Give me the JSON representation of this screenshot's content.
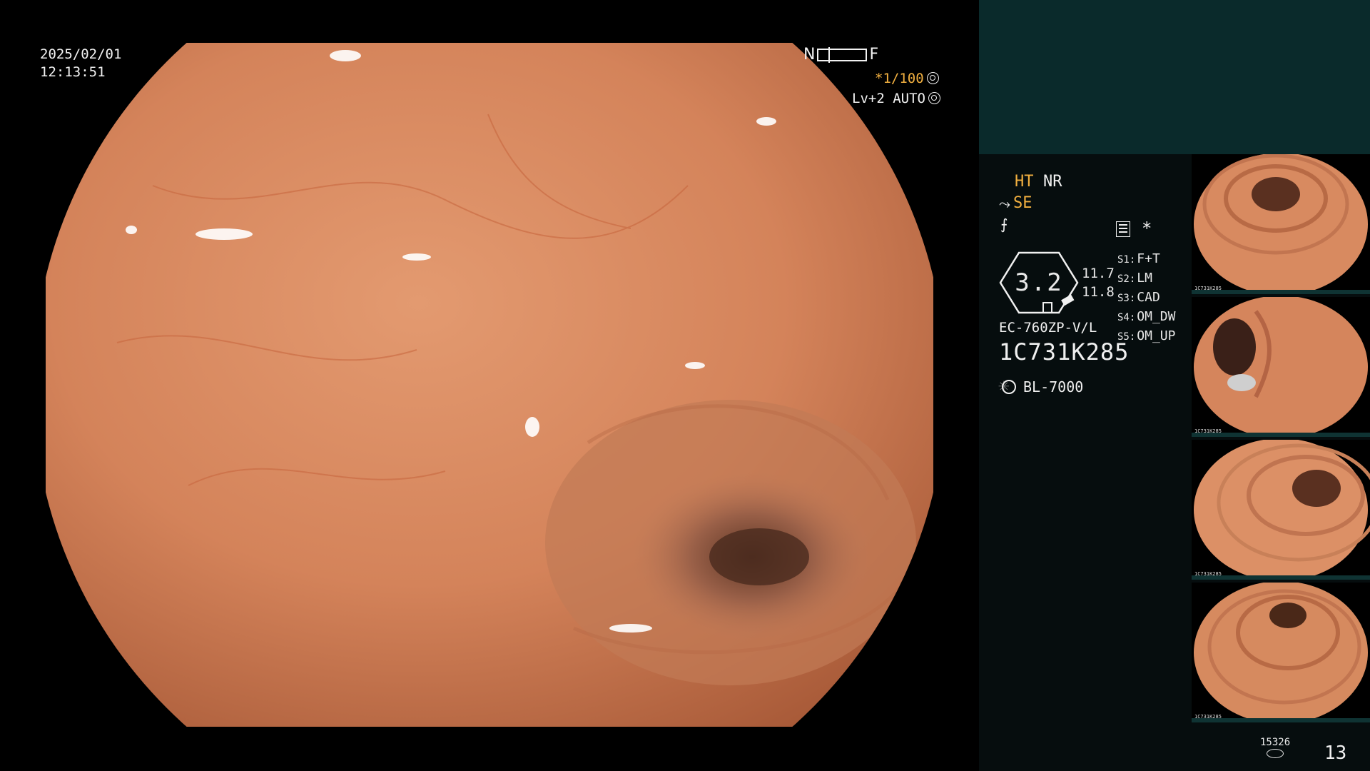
{
  "osd": {
    "date": "2025/02/01",
    "time": "12:13:51",
    "focus_near": "N",
    "focus_far": "F",
    "shutter": "*1/100",
    "level": "Lv+2 AUTO"
  },
  "panel": {
    "ht": "HT",
    "nr": "NR",
    "se": "SE",
    "star": "*",
    "zoom_value": "3.2",
    "value_1": "11.7",
    "value_2": "11.8",
    "settings": [
      {
        "key": "S1:",
        "value": "F+T"
      },
      {
        "key": "S2:",
        "value": "LM"
      },
      {
        "key": "S3:",
        "value": "CAD"
      },
      {
        "key": "S4:",
        "value": "OM_DW"
      },
      {
        "key": "S5:",
        "value": "OM_UP"
      }
    ],
    "scope_model": "EC-760ZP-V/L",
    "serial": "1C731K285",
    "light_source": "BL-7000"
  },
  "thumbnails": [
    {
      "label": "1C731K285"
    },
    {
      "label": "1C731K285"
    },
    {
      "label": "1C731K285"
    },
    {
      "label": "1C731K285"
    }
  ],
  "footer": {
    "storage_count": "15326",
    "image_count": "13"
  },
  "colors": {
    "accent_orange": "#f2b040",
    "panel_top": "#0a2a2b",
    "panel_bg": "#060d0e",
    "tissue": "#d98860"
  }
}
